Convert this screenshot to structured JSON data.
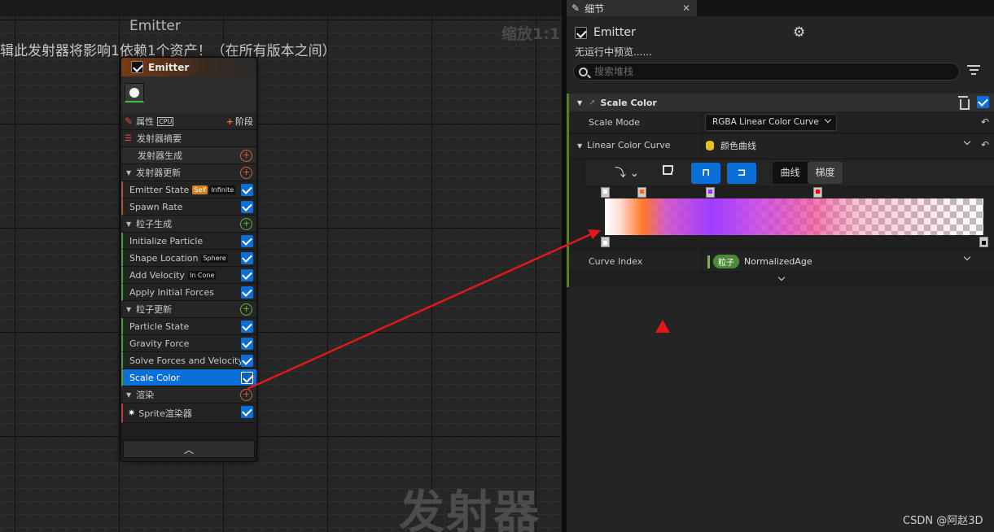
{
  "graph": {
    "title": "Emitter",
    "zoom": "缩放1:1",
    "warning": "辑此发射器将影响1依赖1个资产！（在所有版本之间）",
    "watermark": "发射器"
  },
  "node": {
    "title": "Emitter",
    "properties_label": "属性",
    "cpu_label": "CPU",
    "stage_label": "阶段",
    "summary_label": "发射器摘要",
    "emitter_spawn": "发射器生成",
    "emitter_update": "发射器更新",
    "modules_emitter": [
      {
        "label": "Emitter State",
        "tags": [
          "Self",
          "Infinite"
        ]
      },
      {
        "label": "Spawn Rate",
        "tags": []
      }
    ],
    "particle_spawn": "粒子生成",
    "modules_spawn": [
      {
        "label": "Initialize Particle",
        "tag": ""
      },
      {
        "label": "Shape Location",
        "tag": "Sphere"
      },
      {
        "label": "Add Velocity",
        "tag": "In Cone"
      },
      {
        "label": "Apply Initial Forces",
        "tag": ""
      }
    ],
    "particle_update": "粒子更新",
    "modules_update": [
      {
        "label": "Particle State"
      },
      {
        "label": "Gravity Force"
      },
      {
        "label": "Solve Forces and Velocity"
      },
      {
        "label": "Scale Color",
        "selected": true
      }
    ],
    "render": "渲染",
    "renderer": "Sprite渲染器",
    "collapse_icon": "chevron-up-icon"
  },
  "panel": {
    "tab_title": "细节",
    "emitter_name": "Emitter",
    "preview_text": "无运行中预览......",
    "search_placeholder": "搜索堆栈",
    "section_title": "Scale Color",
    "scale_mode_label": "Scale Mode",
    "scale_mode_value": "RGBA Linear Color Curve",
    "lcc_label": "Linear Color Curve",
    "lcc_value": "颜色曲线",
    "toggle_curve": "曲线",
    "toggle_gradient": "梯度",
    "curve_index_label": "Curve Index",
    "curve_index_tag": "粒子",
    "curve_index_value": "NormalizedAge"
  },
  "gradient": {
    "top_stops": [
      {
        "color": "#ffffff",
        "pos": 0.0
      },
      {
        "color": "#ff6a10",
        "pos": 0.1
      },
      {
        "color": "#a030ff",
        "pos": 0.28
      },
      {
        "color": "#ff0000",
        "pos": 0.56
      }
    ],
    "bottom_stops": [
      {
        "color": "#ffffff",
        "pos": 0.0
      },
      {
        "color": "#000000",
        "pos": 1.0
      }
    ]
  },
  "footer": {
    "credit": "CSDN @阿赵3D"
  },
  "colors": {
    "accent_blue": "#0a70d8",
    "annotation_red": "#e01818"
  }
}
